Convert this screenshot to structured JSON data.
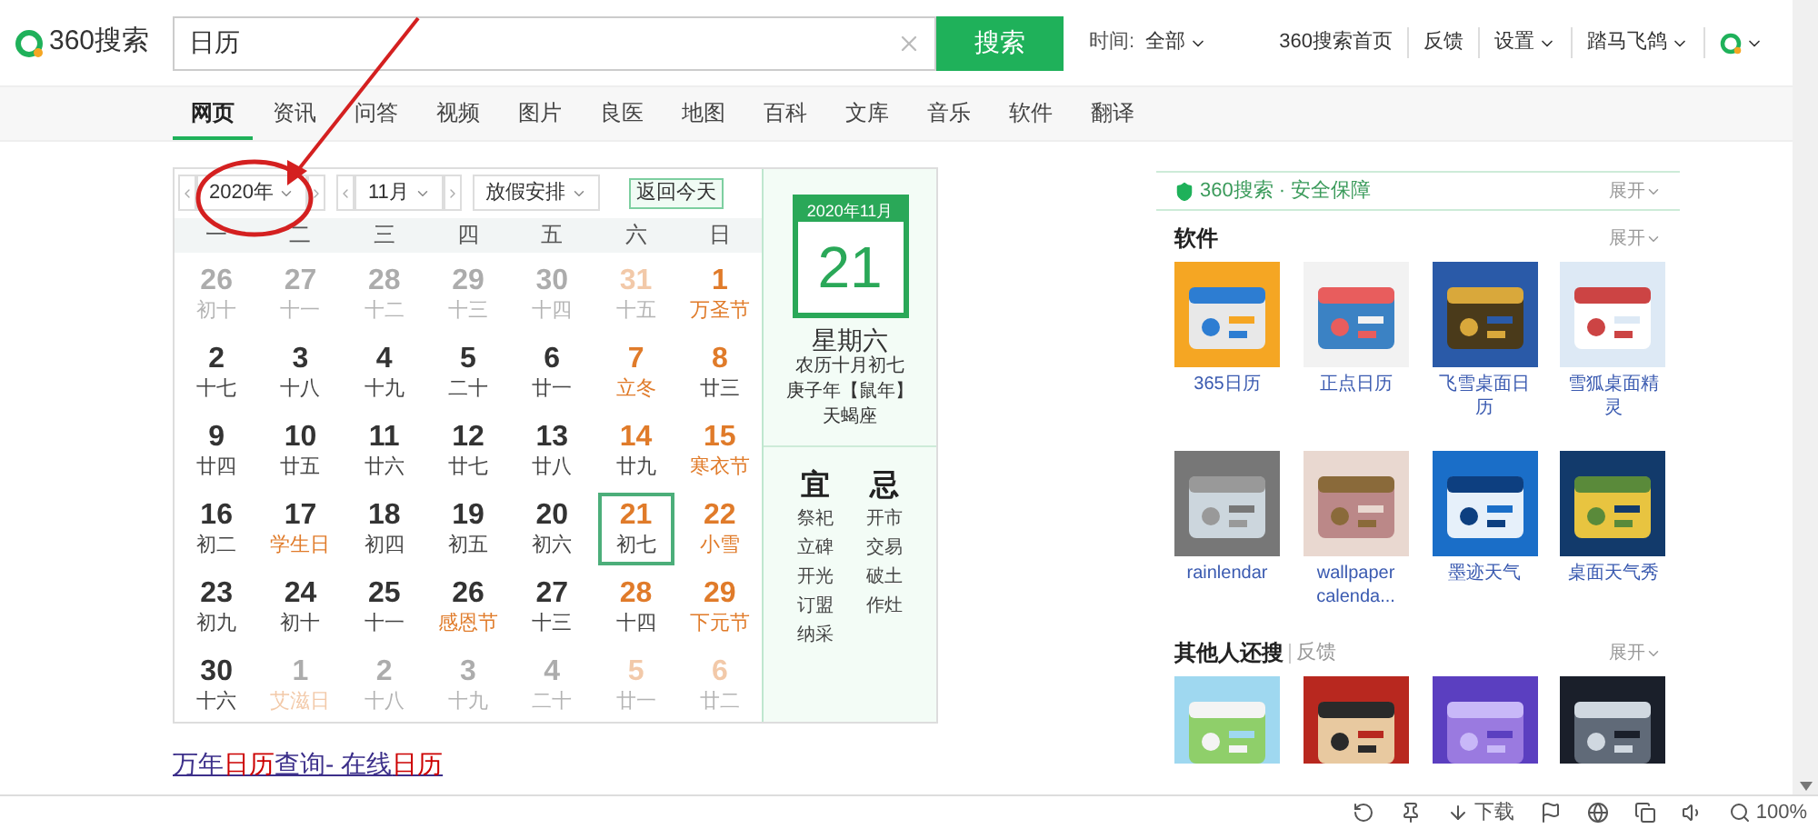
{
  "header": {
    "logo": "360搜索",
    "search": {
      "value": "日历"
    },
    "search_button": "搜索",
    "time_filter": {
      "label": "时间:",
      "value": "全部"
    },
    "links": [
      {
        "label": "360搜索首页",
        "dropdown": false
      },
      {
        "label": "反馈",
        "dropdown": false
      },
      {
        "label": "设置",
        "dropdown": true
      },
      {
        "label": "踏马飞鸽",
        "dropdown": true
      }
    ]
  },
  "tabs": [
    {
      "label": "网页",
      "selected": true
    },
    {
      "label": "资讯",
      "selected": false
    },
    {
      "label": "问答",
      "selected": false
    },
    {
      "label": "视频",
      "selected": false
    },
    {
      "label": "图片",
      "selected": false
    },
    {
      "label": "良医",
      "selected": false
    },
    {
      "label": "地图",
      "selected": false
    },
    {
      "label": "百科",
      "selected": false
    },
    {
      "label": "文库",
      "selected": false
    },
    {
      "label": "音乐",
      "selected": false
    },
    {
      "label": "软件",
      "selected": false
    },
    {
      "label": "翻译",
      "selected": false
    }
  ],
  "calendar": {
    "year": "2020年",
    "month": "11月",
    "holiday": "放假安排",
    "today_button": "返回今天",
    "weekdays": [
      "一",
      "二",
      "三",
      "四",
      "五",
      "六",
      "日"
    ],
    "weeks": [
      [
        {
          "day": "26",
          "lunar": "初十",
          "muted": true,
          "weekend": false,
          "festival": false,
          "selected": false
        },
        {
          "day": "27",
          "lunar": "十一",
          "muted": true,
          "weekend": false,
          "festival": false,
          "selected": false
        },
        {
          "day": "28",
          "lunar": "十二",
          "muted": true,
          "weekend": false,
          "festival": false,
          "selected": false
        },
        {
          "day": "29",
          "lunar": "十三",
          "muted": true,
          "weekend": false,
          "festival": false,
          "selected": false
        },
        {
          "day": "30",
          "lunar": "十四",
          "muted": true,
          "weekend": false,
          "festival": false,
          "selected": false
        },
        {
          "day": "31",
          "lunar": "十五",
          "muted": true,
          "weekend": true,
          "festival": false,
          "selected": false
        },
        {
          "day": "1",
          "lunar": "万圣节",
          "muted": false,
          "weekend": true,
          "festival": true,
          "selected": false
        }
      ],
      [
        {
          "day": "2",
          "lunar": "十七",
          "muted": false,
          "weekend": false,
          "festival": false,
          "selected": false
        },
        {
          "day": "3",
          "lunar": "十八",
          "muted": false,
          "weekend": false,
          "festival": false,
          "selected": false
        },
        {
          "day": "4",
          "lunar": "十九",
          "muted": false,
          "weekend": false,
          "festival": false,
          "selected": false
        },
        {
          "day": "5",
          "lunar": "二十",
          "muted": false,
          "weekend": false,
          "festival": false,
          "selected": false
        },
        {
          "day": "6",
          "lunar": "廿一",
          "muted": false,
          "weekend": false,
          "festival": false,
          "selected": false
        },
        {
          "day": "7",
          "lunar": "立冬",
          "muted": false,
          "weekend": true,
          "festival": true,
          "selected": false
        },
        {
          "day": "8",
          "lunar": "廿三",
          "muted": false,
          "weekend": true,
          "festival": false,
          "selected": false
        }
      ],
      [
        {
          "day": "9",
          "lunar": "廿四",
          "muted": false,
          "weekend": false,
          "festival": false,
          "selected": false
        },
        {
          "day": "10",
          "lunar": "廿五",
          "muted": false,
          "weekend": false,
          "festival": false,
          "selected": false
        },
        {
          "day": "11",
          "lunar": "廿六",
          "muted": false,
          "weekend": false,
          "festival": false,
          "selected": false
        },
        {
          "day": "12",
          "lunar": "廿七",
          "muted": false,
          "weekend": false,
          "festival": false,
          "selected": false
        },
        {
          "day": "13",
          "lunar": "廿八",
          "muted": false,
          "weekend": false,
          "festival": false,
          "selected": false
        },
        {
          "day": "14",
          "lunar": "廿九",
          "muted": false,
          "weekend": true,
          "festival": false,
          "selected": false
        },
        {
          "day": "15",
          "lunar": "寒衣节",
          "muted": false,
          "weekend": true,
          "festival": true,
          "selected": false
        }
      ],
      [
        {
          "day": "16",
          "lunar": "初二",
          "muted": false,
          "weekend": false,
          "festival": false,
          "selected": false
        },
        {
          "day": "17",
          "lunar": "学生日",
          "muted": false,
          "weekend": false,
          "festival": true,
          "selected": false
        },
        {
          "day": "18",
          "lunar": "初四",
          "muted": false,
          "weekend": false,
          "festival": false,
          "selected": false
        },
        {
          "day": "19",
          "lunar": "初五",
          "muted": false,
          "weekend": false,
          "festival": false,
          "selected": false
        },
        {
          "day": "20",
          "lunar": "初六",
          "muted": false,
          "weekend": false,
          "festival": false,
          "selected": false
        },
        {
          "day": "21",
          "lunar": "初七",
          "muted": false,
          "weekend": true,
          "festival": false,
          "selected": true
        },
        {
          "day": "22",
          "lunar": "小雪",
          "muted": false,
          "weekend": true,
          "festival": true,
          "selected": false
        }
      ],
      [
        {
          "day": "23",
          "lunar": "初九",
          "muted": false,
          "weekend": false,
          "festival": false,
          "selected": false
        },
        {
          "day": "24",
          "lunar": "初十",
          "muted": false,
          "weekend": false,
          "festival": false,
          "selected": false
        },
        {
          "day": "25",
          "lunar": "十一",
          "muted": false,
          "weekend": false,
          "festival": false,
          "selected": false
        },
        {
          "day": "26",
          "lunar": "感恩节",
          "muted": false,
          "weekend": false,
          "festival": true,
          "selected": false
        },
        {
          "day": "27",
          "lunar": "十三",
          "muted": false,
          "weekend": false,
          "festival": false,
          "selected": false
        },
        {
          "day": "28",
          "lunar": "十四",
          "muted": false,
          "weekend": true,
          "festival": false,
          "selected": false
        },
        {
          "day": "29",
          "lunar": "下元节",
          "muted": false,
          "weekend": true,
          "festival": true,
          "selected": false
        }
      ],
      [
        {
          "day": "30",
          "lunar": "十六",
          "muted": false,
          "weekend": false,
          "festival": false,
          "selected": false
        },
        {
          "day": "1",
          "lunar": "艾滋日",
          "muted": true,
          "weekend": false,
          "festival": true,
          "selected": false
        },
        {
          "day": "2",
          "lunar": "十八",
          "muted": true,
          "weekend": false,
          "festival": false,
          "selected": false
        },
        {
          "day": "3",
          "lunar": "十九",
          "muted": true,
          "weekend": false,
          "festival": false,
          "selected": false
        },
        {
          "day": "4",
          "lunar": "二十",
          "muted": true,
          "weekend": false,
          "festival": false,
          "selected": false
        },
        {
          "day": "5",
          "lunar": "廿一",
          "muted": true,
          "weekend": true,
          "festival": false,
          "selected": false
        },
        {
          "day": "6",
          "lunar": "廿二",
          "muted": true,
          "weekend": true,
          "festival": false,
          "selected": false
        }
      ]
    ],
    "detail": {
      "month": "2020年11月",
      "day": "21",
      "weekday": "星期六",
      "lunar": "农历十月初七",
      "ganzhi": "庚子年【鼠年】",
      "zodiac": "天蝎座",
      "good_title": "宜",
      "good": [
        "祭祀",
        "立碑",
        "开光",
        "订盟",
        "纳采"
      ],
      "bad_title": "忌",
      "bad": [
        "开市",
        "交易",
        "破土",
        "作灶"
      ]
    }
  },
  "result": {
    "title": [
      {
        "text": "万年",
        "highlight": false
      },
      {
        "text": "日历",
        "highlight": true
      },
      {
        "text": "查询- 在线",
        "highlight": false
      },
      {
        "text": "日历",
        "highlight": true
      }
    ]
  },
  "sidebar": {
    "safety": {
      "label": "360搜索 · 安全保障",
      "expand": "展开"
    },
    "software": {
      "title": "软件",
      "expand": "展开",
      "items": [
        {
          "label": "365日历"
        },
        {
          "label": "正点日历"
        },
        {
          "label": "飞雪桌面日历"
        },
        {
          "label": "雪狐桌面精灵"
        },
        {
          "label": "rainlendar"
        },
        {
          "label": "wallpaper calenda..."
        },
        {
          "label": "墨迹天气"
        },
        {
          "label": "桌面天气秀"
        }
      ]
    },
    "related": {
      "title": "其他人还搜",
      "feedback": "反馈",
      "expand": "展开"
    }
  },
  "status_bar": {
    "download": "下载",
    "zoom": "100%"
  }
}
